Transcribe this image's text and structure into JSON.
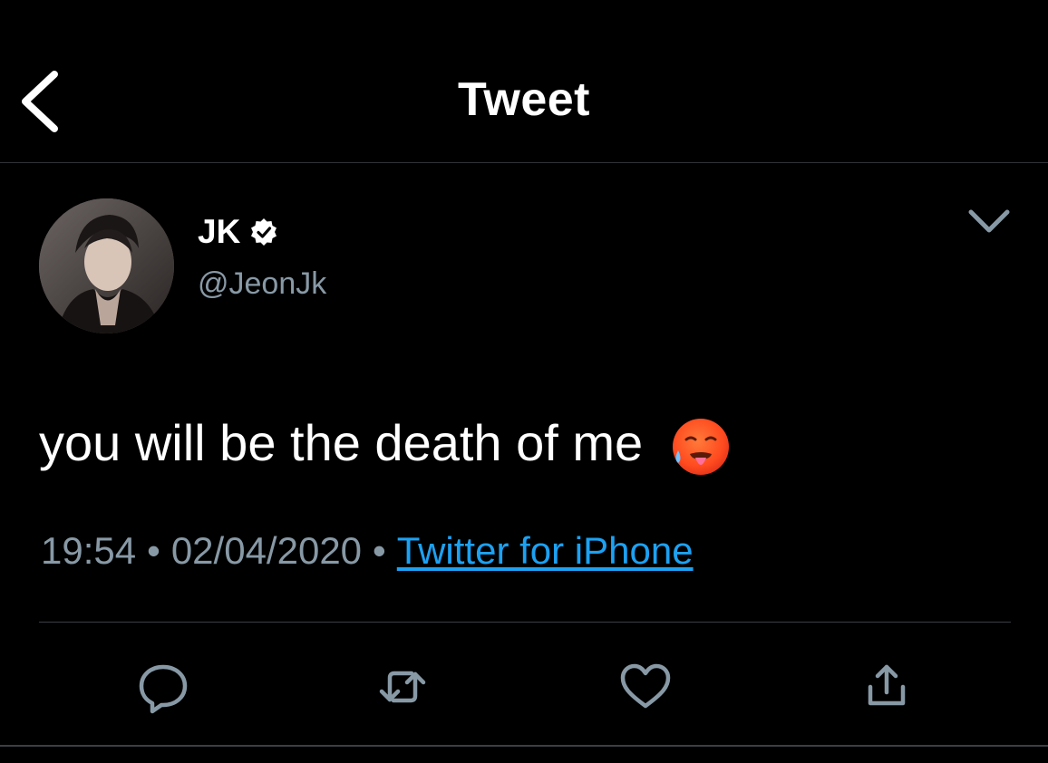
{
  "header": {
    "title": "Tweet",
    "back_icon": "chevron-left-icon"
  },
  "tweet": {
    "display_name": "JK",
    "verified": true,
    "handle": "@JeonJk",
    "text": "you will be the death of me",
    "emoji": "hot-face-emoji",
    "time": "19:54",
    "separator": "•",
    "date": "02/04/2020",
    "source": "Twitter for iPhone",
    "menu_icon": "chevron-down-icon"
  },
  "actions": [
    {
      "name": "reply",
      "icon": "reply-icon"
    },
    {
      "name": "retweet",
      "icon": "retweet-icon"
    },
    {
      "name": "like",
      "icon": "heart-icon"
    },
    {
      "name": "share",
      "icon": "share-icon"
    }
  ],
  "colors": {
    "background": "#000000",
    "text": "#ffffff",
    "secondary": "#8899a6",
    "link": "#1da1f2",
    "divider": "#3a3f44"
  }
}
